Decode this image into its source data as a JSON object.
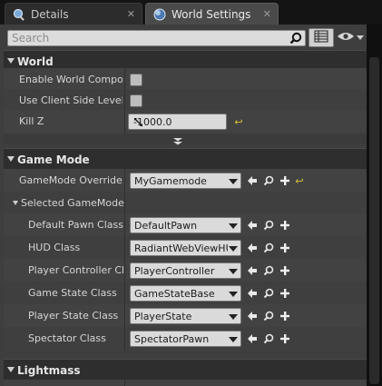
{
  "tabs": [
    {
      "label": "Details",
      "icon": "details-icon"
    },
    {
      "label": "World Settings",
      "icon": "world-globe-icon"
    }
  ],
  "search": {
    "placeholder": "Search"
  },
  "categories": {
    "world": "World",
    "game_mode": "Game Mode",
    "lightmass": "Lightmass"
  },
  "world": {
    "enable_world_composition": {
      "label": "Enable World Composit",
      "checked": false
    },
    "use_client_side_level_streaming": {
      "label": "Use Client Side Level S",
      "checked": false
    },
    "kill_z": {
      "label": "Kill Z",
      "value": "-1000.0"
    }
  },
  "game_mode": {
    "override": {
      "label": "GameMode Override",
      "value": "MyGamemode"
    },
    "selected_group": "Selected GameMode",
    "properties": [
      {
        "label": "Default Pawn Class",
        "value": "DefaultPawn"
      },
      {
        "label": "HUD Class",
        "value": "RadiantWebViewHUD"
      },
      {
        "label": "Player Controller Clas",
        "value": "PlayerController"
      },
      {
        "label": "Game State Class",
        "value": "GameStateBase"
      },
      {
        "label": "Player State Class",
        "value": "PlayerState"
      },
      {
        "label": "Spectator Class",
        "value": "SpectatorPawn"
      }
    ]
  },
  "colors": {
    "reset_arrow": "#d8c23a",
    "panel": "#3e3e3e",
    "category": "#2e2e2e"
  }
}
